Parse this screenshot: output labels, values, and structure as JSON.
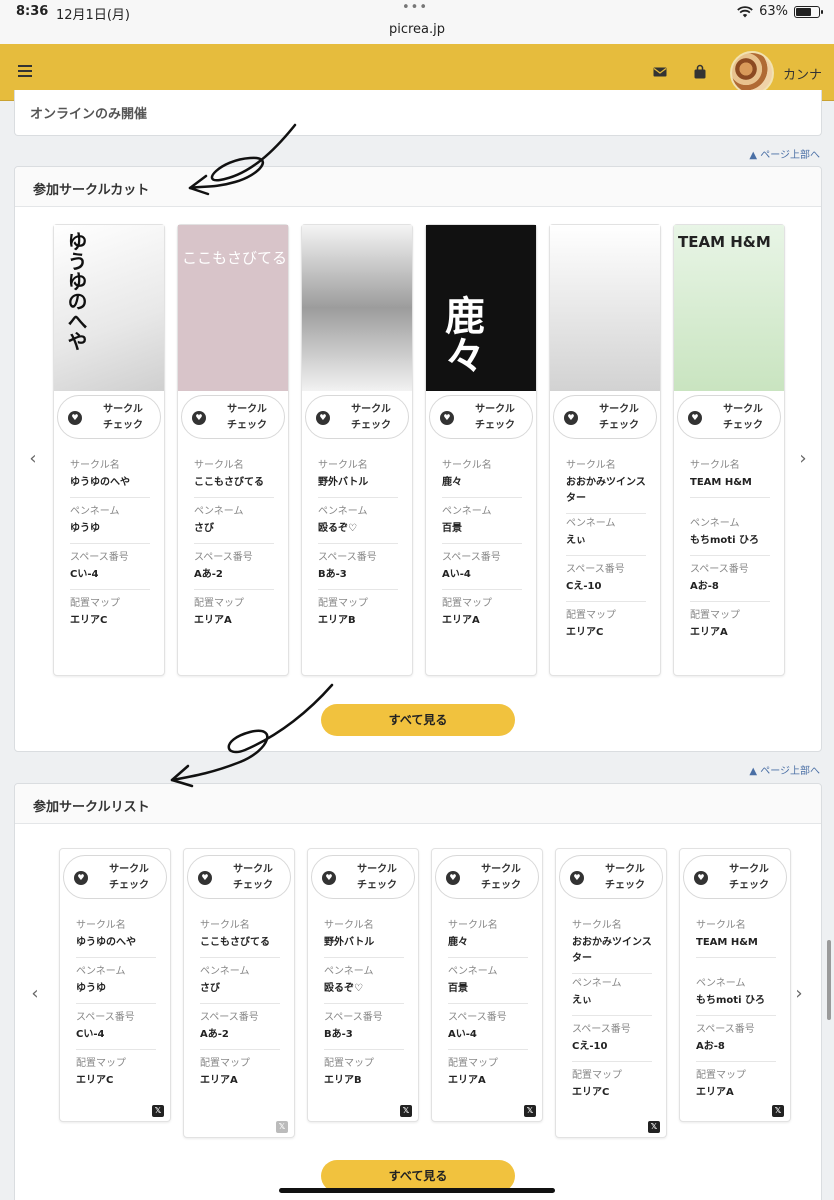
{
  "status_bar": {
    "time": "8:36",
    "date": "12月1日(月)",
    "url": "picrea.jp",
    "battery": "63%"
  },
  "header": {
    "username": "カンナ",
    "icons": [
      "menu-icon",
      "mail-icon",
      "bag-icon",
      "avatar"
    ]
  },
  "online_only": "オンラインのみ開催",
  "page_top_link": "▲ ページ上部へ",
  "labels": {
    "circle_check": [
      "サークル",
      "チェック"
    ],
    "circle_name": "サークル名",
    "pen_name": "ペンネーム",
    "space_no": "スペース番号",
    "map": "配置マップ",
    "see_all": "すべて見る"
  },
  "cut_section": {
    "title": "参加サークルカット",
    "image_texts": [
      "ゆうゆのへや",
      "ここもさびてる",
      "",
      "鹿々",
      "",
      "TEAM H&M"
    ]
  },
  "list_section": {
    "title": "参加サークルリスト"
  },
  "circles": [
    {
      "name": "ゆうゆのへや",
      "pen": "ゆうゆ",
      "space": "Cい-4",
      "map": "エリアC"
    },
    {
      "name": "ここもさびてる",
      "pen": "さび",
      "space": "Aあ-2",
      "map": "エリアA"
    },
    {
      "name": "野外バトル",
      "pen": "殴るぞ♡",
      "space": "Bあ-3",
      "map": "エリアB"
    },
    {
      "name": "鹿々",
      "pen": "百景",
      "space": "Aい-4",
      "map": "エリアA"
    },
    {
      "name": "おおかみツインスター",
      "pen": "えぃ",
      "space": "Cえ-10",
      "map": "エリアC"
    },
    {
      "name": "TEAM H&M",
      "pen": "もちmoti ひろ",
      "space": "Aお-8",
      "map": "エリアA"
    }
  ],
  "colors": {
    "header": "#e6bc3d",
    "button": "#f1c23e"
  }
}
